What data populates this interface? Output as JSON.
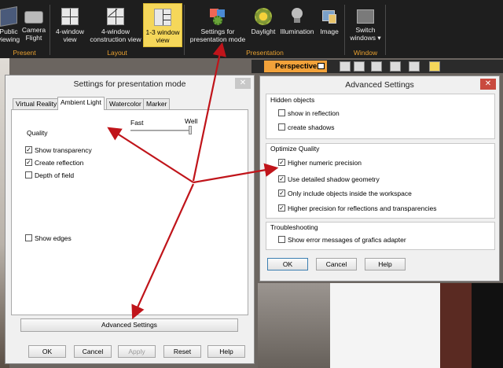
{
  "ribbon": {
    "buttons": [
      {
        "label": "Public\nviewing",
        "icon": "display-icon"
      },
      {
        "label": "Camera\nFlight",
        "icon": "camera-icon"
      },
      {
        "label": "4-window\nview",
        "icon": "four-window-icon"
      },
      {
        "label": "4-window\nconstruction view",
        "icon": "construction-view-icon"
      },
      {
        "label": "1-3 window\nview",
        "icon": "one-three-window-icon"
      },
      {
        "label": "Settings for\npresentation mode",
        "icon": "presentation-settings-icon"
      },
      {
        "label": "Daylight",
        "icon": "sun-icon"
      },
      {
        "label": "Illumination",
        "icon": "lightbulb-icon"
      },
      {
        "label": "Image",
        "icon": "image-icon"
      },
      {
        "label": "Switch\nwindows ▾",
        "icon": "switch-windows-icon"
      }
    ],
    "groups": {
      "present": "Present",
      "layout": "Layout",
      "presentation": "Presentation",
      "window": "Window"
    }
  },
  "perspective_label": "Perspective",
  "settings_dialog": {
    "title": "Settings for presentation mode",
    "tabs": [
      "Virtual Reality",
      "Ambient Light",
      "Watercolor",
      "Marker"
    ],
    "quality_label": "Quality",
    "slider_fast": "Fast",
    "slider_well": "Well",
    "checkboxes": [
      {
        "label": "Show transparency",
        "checked": "✓"
      },
      {
        "label": "Create reflection",
        "checked": "✓"
      },
      {
        "label": "Depth of field",
        "checked": ""
      },
      {
        "label": "Show edges",
        "checked": ""
      }
    ],
    "advanced_button": "Advanced Settings",
    "buttons": {
      "ok": "OK",
      "cancel": "Cancel",
      "apply": "Apply",
      "reset": "Reset",
      "help": "Help"
    }
  },
  "advanced_dialog": {
    "title": "Advanced Settings",
    "groups": [
      {
        "title": "Hidden objects",
        "items": [
          {
            "label": "show in reflection",
            "checked": ""
          },
          {
            "label": "create shadows",
            "checked": ""
          }
        ]
      },
      {
        "title": "Optimize Quality",
        "items": [
          {
            "label": "Higher numeric precision",
            "checked": "✓"
          },
          {
            "label": "Use detailed shadow geometry",
            "checked": "✓"
          },
          {
            "label": "Only include objects inside the workspace",
            "checked": "✓"
          },
          {
            "label": "Higher precision for reflections and transparencies",
            "checked": "✓"
          }
        ]
      },
      {
        "title": "Troubleshooting",
        "items": [
          {
            "label": "Show error messages of grafics adapter",
            "checked": ""
          }
        ]
      }
    ],
    "buttons": {
      "ok": "OK",
      "cancel": "Cancel",
      "help": "Help"
    }
  },
  "colors": {
    "accent_orange": "#e8a030",
    "active_yellow": "#f5d75a",
    "arrow_red": "#c0141a"
  }
}
